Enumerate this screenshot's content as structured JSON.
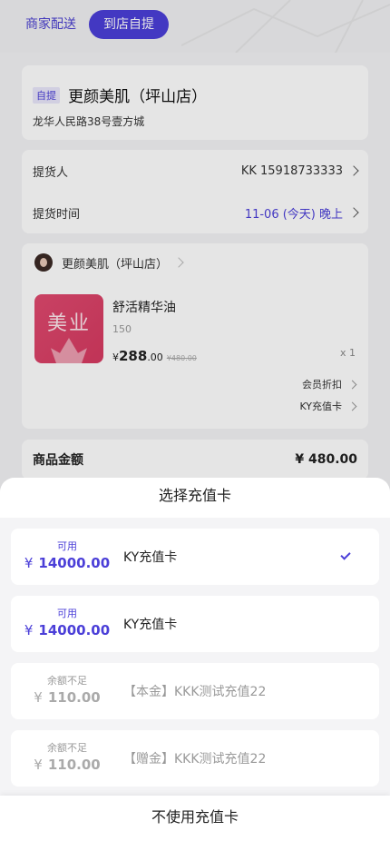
{
  "delivery_tabs": {
    "merchant": "商家配送",
    "pickup": "到店自提"
  },
  "store": {
    "tag": "自提",
    "name": "更颜美肌（坪山店）",
    "address": "龙华人民路38号壹方城"
  },
  "pickup": {
    "person_label": "提货人",
    "person_value": "KK 15918733333",
    "time_label": "提货时间",
    "time_value": "11-06 (今天) 晚上"
  },
  "order": {
    "shop_name": "更颜美肌（坪山店）",
    "product": {
      "image_text": "美业",
      "name": "舒活精华油",
      "spec": "150",
      "price_symbol": "¥",
      "price_int": "288",
      "price_dec": ".00",
      "original_price": "¥480.00",
      "quantity": "x 1"
    },
    "member_discount": "会员折扣",
    "stored_card": "KY充值卡"
  },
  "summary": {
    "goods_amount_label": "商品金额",
    "goods_amount_value": "¥ 480.00"
  },
  "sheet": {
    "title": "选择充值卡",
    "cards": [
      {
        "status": "可用",
        "yen": "¥",
        "amount": "14000.00",
        "name": "KY充值卡",
        "selected": true
      },
      {
        "status": "可用",
        "yen": "¥",
        "amount": "14000.00",
        "name": "KY充值卡",
        "selected": false
      },
      {
        "status": "余额不足",
        "yen": "¥",
        "amount": "110.00",
        "name": "【本金】KKK测试充值22",
        "selected": false
      },
      {
        "status": "余额不足",
        "yen": "¥",
        "amount": "110.00",
        "name": "【赠金】KKK测试充值22",
        "selected": false
      }
    ],
    "footer_button": "不使用充值卡"
  },
  "colors": {
    "accent": "#4b3fd8",
    "product_bg": "#e04a6f"
  }
}
